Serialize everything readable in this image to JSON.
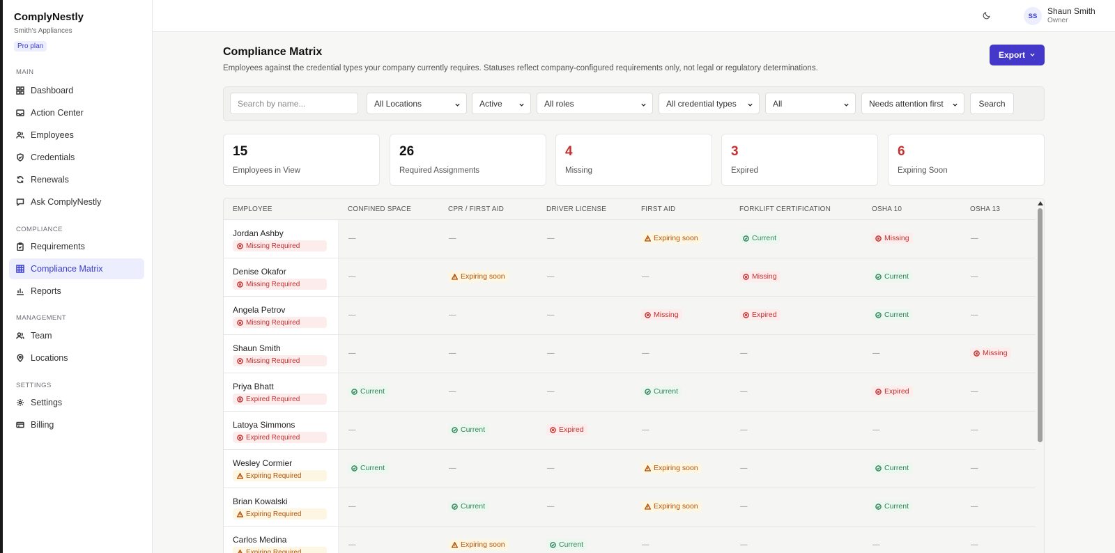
{
  "app": {
    "name": "ComplyNestly",
    "company": "Smith's Appliances",
    "plan": "Pro plan"
  },
  "nav": {
    "sections": [
      "MAIN",
      "COMPLIANCE",
      "MANAGEMENT",
      "SETTINGS"
    ],
    "items": [
      {
        "label": "Dashboard",
        "icon": "grid-icon"
      },
      {
        "label": "Action Center",
        "icon": "inbox-icon"
      },
      {
        "label": "Employees",
        "icon": "users-icon"
      },
      {
        "label": "Credentials",
        "icon": "shield-icon"
      },
      {
        "label": "Renewals",
        "icon": "refresh-icon"
      },
      {
        "label": "Ask ComplyNestly",
        "icon": "chat-icon"
      },
      {
        "label": "Requirements",
        "icon": "clipboard-icon"
      },
      {
        "label": "Compliance Matrix",
        "icon": "table-icon"
      },
      {
        "label": "Reports",
        "icon": "bar-chart-icon"
      },
      {
        "label": "Team",
        "icon": "users-icon"
      },
      {
        "label": "Locations",
        "icon": "map-pin-icon"
      },
      {
        "label": "Settings",
        "icon": "gear-icon"
      },
      {
        "label": "Billing",
        "icon": "credit-card-icon"
      }
    ]
  },
  "user": {
    "initials": "SS",
    "name": "Shaun Smith",
    "role": "Owner"
  },
  "page": {
    "title": "Compliance Matrix",
    "description": "Employees against the credential types your company currently requires. Statuses reflect company-configured requirements only, not legal or regulatory determinations.",
    "export_label": "Export"
  },
  "filters": {
    "search_placeholder": "Search by name...",
    "location": "All Locations",
    "status": "Active",
    "role": "All roles",
    "credential_type": "All credential types",
    "compliance": "All",
    "sort": "Needs attention first",
    "search_button": "Search"
  },
  "stats": [
    {
      "value": "15",
      "label": "Employees in View",
      "color": "#111111"
    },
    {
      "value": "26",
      "label": "Required Assignments",
      "color": "#111111"
    },
    {
      "value": "4",
      "label": "Missing",
      "color": "#c53030"
    },
    {
      "value": "3",
      "label": "Expired",
      "color": "#c53030"
    },
    {
      "value": "6",
      "label": "Expiring Soon",
      "color": "#c53030"
    }
  ],
  "table": {
    "columns": [
      "EMPLOYEE",
      "CONFINED SPACE",
      "CPR / FIRST AID",
      "DRIVER LICENSE",
      "FIRST AID",
      "FORKLIFT CERTIFICATION",
      "OSHA 10",
      "OSHA 13"
    ],
    "dash": "—",
    "status_labels": {
      "current": "Current",
      "missing": "Missing",
      "expired": "Expired",
      "expiring": "Expiring soon"
    },
    "rows": [
      {
        "name": "Jordan Ashby",
        "badge": "Missing Required",
        "badge_type": "missing",
        "cells": [
          "dash",
          "dash",
          "dash",
          "expiring",
          "current",
          "missing",
          "dash"
        ]
      },
      {
        "name": "Denise Okafor",
        "badge": "Missing Required",
        "badge_type": "missing",
        "cells": [
          "dash",
          "expiring",
          "dash",
          "dash",
          "missing",
          "current",
          "dash"
        ]
      },
      {
        "name": "Angela Petrov",
        "badge": "Missing Required",
        "badge_type": "missing",
        "cells": [
          "dash",
          "dash",
          "dash",
          "missing",
          "expired",
          "current",
          "dash"
        ]
      },
      {
        "name": "Shaun Smith",
        "badge": "Missing Required",
        "badge_type": "missing",
        "cells": [
          "dash",
          "dash",
          "dash",
          "dash",
          "dash",
          "dash",
          "missing"
        ]
      },
      {
        "name": "Priya Bhatt",
        "badge": "Expired Required",
        "badge_type": "expired",
        "cells": [
          "current",
          "dash",
          "dash",
          "current",
          "dash",
          "expired",
          "dash"
        ]
      },
      {
        "name": "Latoya Simmons",
        "badge": "Expired Required",
        "badge_type": "expired",
        "cells": [
          "dash",
          "current",
          "expired",
          "dash",
          "dash",
          "dash",
          "dash"
        ]
      },
      {
        "name": "Wesley Cormier",
        "badge": "Expiring Required",
        "badge_type": "expiring",
        "cells": [
          "current",
          "dash",
          "dash",
          "expiring",
          "dash",
          "current",
          "dash"
        ]
      },
      {
        "name": "Brian Kowalski",
        "badge": "Expiring Required",
        "badge_type": "expiring",
        "cells": [
          "dash",
          "current",
          "dash",
          "expiring",
          "dash",
          "current",
          "dash"
        ]
      },
      {
        "name": "Carlos Medina",
        "badge": "Expiring Required",
        "badge_type": "expiring",
        "cells": [
          "dash",
          "expiring",
          "current",
          "dash",
          "dash",
          "dash",
          "dash"
        ]
      }
    ]
  }
}
